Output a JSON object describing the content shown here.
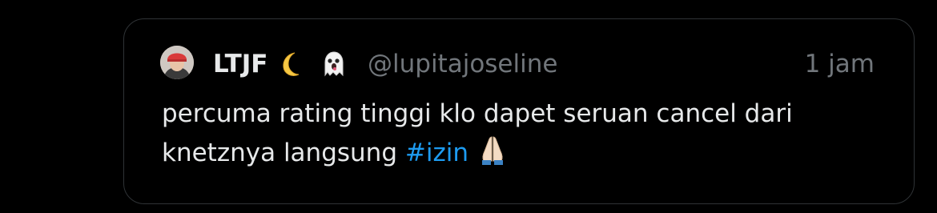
{
  "tweet": {
    "display_name": "LTJF",
    "name_emojis": [
      "crescent-moon-icon",
      "ghost-icon"
    ],
    "handle": "@lupitajoseline",
    "timestamp": "1 jam",
    "text_line1": "percuma rating tinggi klo dapet seruan cancel dari",
    "text_line2": "knetznya langsung",
    "hashtag": "#izin",
    "trailing_emoji": "folded-hands-icon"
  },
  "colors": {
    "background": "#000000",
    "text_primary": "#e7e9ea",
    "text_secondary": "#71767b",
    "link": "#1d9bf0",
    "border": "#2f3336"
  }
}
